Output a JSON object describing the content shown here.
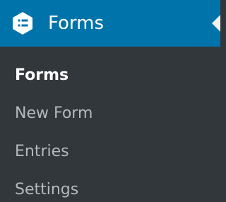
{
  "colors": {
    "header_bg": "#0073aa",
    "sidebar_bg": "#32373c",
    "current_text": "#ffffff",
    "inactive_text": "#b4b9be",
    "arrow_color": "#f1f1f1"
  },
  "header": {
    "title": "Forms",
    "icon": "forms-list-icon"
  },
  "submenu": [
    {
      "label": "Forms",
      "current": true
    },
    {
      "label": "New Form",
      "current": false
    },
    {
      "label": "Entries",
      "current": false
    },
    {
      "label": "Settings",
      "current": false
    }
  ]
}
